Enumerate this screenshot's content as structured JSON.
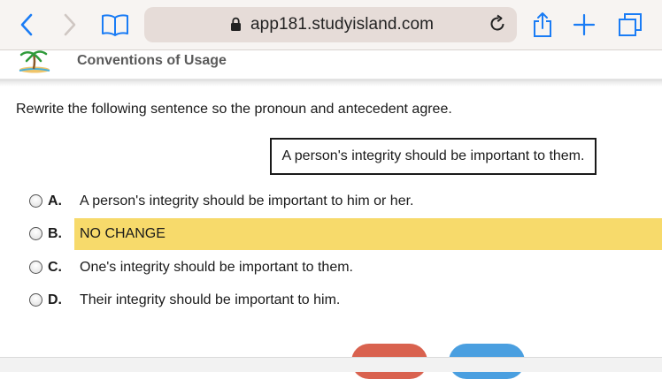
{
  "browser": {
    "url": "app181.studyisland.com",
    "icons": {
      "back": "chevron-left-icon",
      "forward": "chevron-right-icon",
      "bookmarks": "book-icon",
      "lock": "lock-icon",
      "reload": "reload-icon",
      "share": "share-icon",
      "new_tab": "plus-icon",
      "tabs": "tabs-icon"
    },
    "accent_color": "#1a7cf5"
  },
  "app": {
    "section_title": "Conventions of Usage",
    "logo_icon": "palm-tree-icon"
  },
  "question": {
    "prompt": "Rewrite the following sentence so the pronoun and antecedent agree.",
    "sentence": "A person's integrity should be important to them."
  },
  "options": [
    {
      "letter": "A.",
      "text": "A person's integrity should be important to him or her.",
      "highlighted": false
    },
    {
      "letter": "B.",
      "text": "NO CHANGE",
      "highlighted": true
    },
    {
      "letter": "C.",
      "text": "One's integrity should be important to them.",
      "highlighted": false
    },
    {
      "letter": "D.",
      "text": "Their integrity should be important to him.",
      "highlighted": false
    }
  ],
  "colors": {
    "highlight": "#f7da6b",
    "button_red": "#d9624f",
    "button_blue": "#4a9fe0"
  }
}
